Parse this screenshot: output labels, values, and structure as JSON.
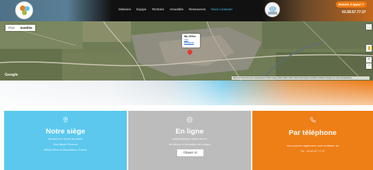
{
  "header": {
    "nav": [
      "Missions",
      "Equipe",
      "Territoire",
      "Actualités",
      "Ressources",
      "Nous contacter"
    ],
    "active_nav": "Nous contacter",
    "cta_button": "Besoin d'appui ?",
    "phone": "03.59.57.77.37"
  },
  "map": {
    "type_buttons": [
      "Plan",
      "Satellite"
    ],
    "selected_type": "Satellite",
    "info_title": "My Office",
    "info_links": [
      "Link",
      "Directions"
    ],
    "brand": "Google",
    "attribution": "Raccourcis clavier  Données cartographiques ©2023 Images ©2023 CNES / Airbus, Maxar Technologies  Conditions d'utilisation  Signaler une erreur cartographique",
    "controls": {
      "fullscreen": "⛶",
      "zoom_in": "+",
      "zoom_out": "−"
    }
  },
  "panels": [
    {
      "icon": "location-icon",
      "title": "Notre siège",
      "lines": [
        "Accueil non ouvert au public",
        "Rue Marie Pecoroni",
        "59139 Flers en Escrebieux, France"
      ]
    },
    {
      "icon": "globe-icon",
      "title": "En ligne",
      "lines": [
        "contact@appui-sante-nord.fr",
        "ou utilisez le formulaire de contact"
      ],
      "button": "Cliquez ici"
    },
    {
      "icon": "phone-icon",
      "title": "Par téléphone",
      "lines": [
        "Vous pouvez également nous contacter au",
        "Tél : 03 59 57 77 37"
      ]
    }
  ],
  "colors": {
    "blue": "#5cc8ee",
    "grey": "#bcbcbc",
    "orange": "#ee7e16"
  }
}
